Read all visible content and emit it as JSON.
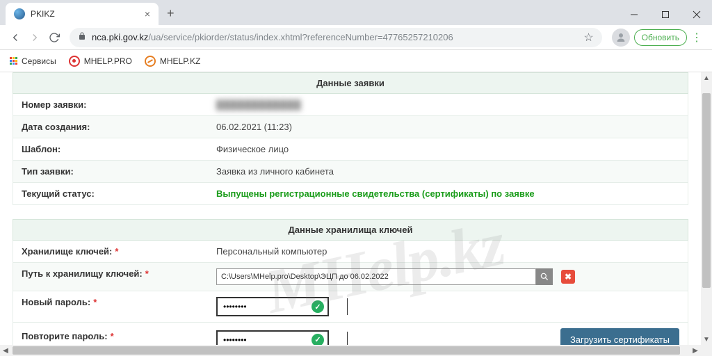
{
  "browser": {
    "tab_title": "PKIKZ",
    "url_domain": "nca.pki.gov.kz",
    "url_path": "/ua/service/pkiorder/status/index.xhtml?referenceNumber=47765257210206",
    "update_label": "Обновить"
  },
  "bookmarks": {
    "services": "Сервисы",
    "mhelp_pro": "MHELP.PRO",
    "mhelp_kz": "MHELP.KZ"
  },
  "section1": {
    "title": "Данные заявки",
    "row1_label": "Номер заявки:",
    "row1_value": "████████████",
    "row2_label": "Дата создания:",
    "row2_value": "06.02.2021 (11:23)",
    "row3_label": "Шаблон:",
    "row3_value": "Физическое лицо",
    "row4_label": "Тип заявки:",
    "row4_value": "Заявка из личного кабинета",
    "row5_label": "Текущий статус:",
    "row5_value": "Выпущены регистрационные свидетельства (сертификаты) по заявке"
  },
  "section2": {
    "title": "Данные хранилища ключей",
    "storage_label": "Хранилище ключей:",
    "storage_value": "Персональный компьютер",
    "path_label": "Путь к хранилищу ключей:",
    "path_value": "C:\\Users\\MHelp.pro\\Desktop\\ЭЦП до 06.02.2022",
    "newpwd_label": "Новый пароль:",
    "newpwd_value": "••••••••",
    "reppwd_label": "Повторите пароль:",
    "reppwd_value": "••••••••",
    "load_button": "Загрузить сертификаты"
  },
  "watermark": "MHelp.kz"
}
